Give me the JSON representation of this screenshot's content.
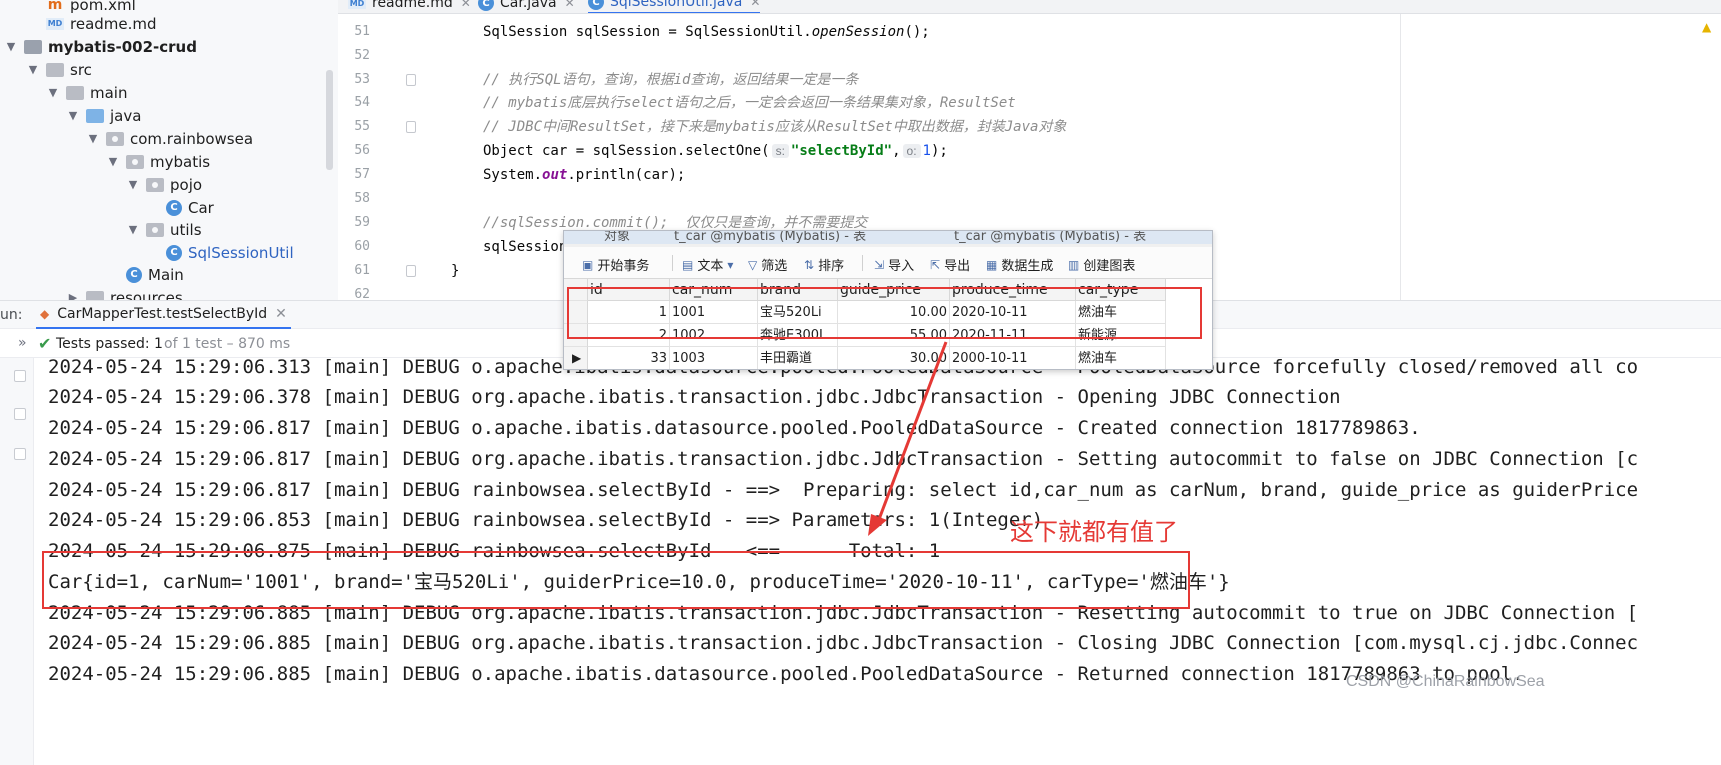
{
  "project_tree": {
    "items": [
      {
        "label": "pom.xml",
        "icon": "maven-file-icon"
      },
      {
        "label": "readme.md",
        "icon": "markdown-file-icon"
      },
      {
        "label": "mybatis-002-crud",
        "icon": "module-folder-icon"
      },
      {
        "label": "src",
        "icon": "folder-icon"
      },
      {
        "label": "main",
        "icon": "folder-icon"
      },
      {
        "label": "java",
        "icon": "source-folder-icon"
      },
      {
        "label": "com.rainbowsea",
        "icon": "package-icon"
      },
      {
        "label": "mybatis",
        "icon": "package-icon"
      },
      {
        "label": "pojo",
        "icon": "package-icon"
      },
      {
        "label": "Car",
        "icon": "class-icon"
      },
      {
        "label": "utils",
        "icon": "package-icon"
      },
      {
        "label": "SqlSessionUtil",
        "icon": "class-icon"
      },
      {
        "label": "Main",
        "icon": "class-icon"
      },
      {
        "label": "resources",
        "icon": "folder-icon"
      }
    ]
  },
  "editor": {
    "tabs": [
      {
        "label": "readme.md"
      },
      {
        "label": "Car.java"
      },
      {
        "label": "SqlSessionUtil.java"
      }
    ],
    "line_numbers": [
      "51",
      "52",
      "53",
      "54",
      "55",
      "56",
      "57",
      "58",
      "59",
      "60",
      "61",
      "62"
    ],
    "lines": {
      "l51_a": "SqlSession sqlSession = SqlSessionUtil.",
      "l51_b": "openSession",
      "l51_c": "();",
      "l53": "// 执行SQL语句，查询，根据id查询，返回结果一定是一条",
      "l54": "// mybatis底层执行select语句之后，一定会会返回一条结果集对象，ResultSet",
      "l55": "// JDBC中间ResultSet，接下来是mybatis应该从ResultSet中取出数据，封装Java对象",
      "l56_a": "Object car = sqlSession.selectOne(",
      "l56_hint1": "s:",
      "l56_str": "\"selectById\"",
      "l56_comma": ",",
      "l56_hint2": "o:",
      "l56_num": "1",
      "l56_end": ");",
      "l57_a": "System.",
      "l57_out": "out",
      "l57_b": ".println(car);",
      "l59": "//sqlSession.commit();  仅仅只是查询，并不需要提交",
      "l60": "sqlSession",
      "l61": "}"
    }
  },
  "run_panel": {
    "prefix": "un:",
    "tab_label": "CarMapperTest.testSelectById",
    "test_status": "Tests passed: 1",
    "test_detail": "of 1 test – 870 ms"
  },
  "console": {
    "lines": [
      "2024-05-24 15:29:06.313 [main] DEBUG o.apache.ibatis.datasource.pooled.PooledDataSource - PooledDataSource forcefully closed/removed all co",
      "2024-05-24 15:29:06.378 [main] DEBUG org.apache.ibatis.transaction.jdbc.JdbcTransaction - Opening JDBC Connection",
      "2024-05-24 15:29:06.817 [main] DEBUG o.apache.ibatis.datasource.pooled.PooledDataSource - Created connection 1817789863.",
      "2024-05-24 15:29:06.817 [main] DEBUG org.apache.ibatis.transaction.jdbc.JdbcTransaction - Setting autocommit to false on JDBC Connection [c",
      "2024-05-24 15:29:06.817 [main] DEBUG rainbowsea.selectById - ==>  Preparing: select id,car_num as carNum, brand, guide_price as guiderPrice",
      "2024-05-24 15:29:06.853 [main] DEBUG rainbowsea.selectById - ==> Parameters: 1(Integer)",
      "2024-05-24 15:29:06.875 [main] DEBUG rainbowsea.selectById - <==      Total: 1",
      "Car{id=1, carNum='1001', brand='宝马520Li', guiderPrice=10.0, produceTime='2020-10-11', carType='燃油车'}",
      "2024-05-24 15:29:06.885 [main] DEBUG org.apache.ibatis.transaction.jdbc.JdbcTransaction - Resetting autocommit to true on JDBC Connection [",
      "2024-05-24 15:29:06.885 [main] DEBUG org.apache.ibatis.transaction.jdbc.JdbcTransaction - Closing JDBC Connection [com.mysql.cj.jdbc.Connec",
      "2024-05-24 15:29:06.885 [main] DEBUG o.apache.ibatis.datasource.pooled.PooledDataSource - Returned connection 1817789863 to pool."
    ]
  },
  "db_window": {
    "tabs": [
      "对象",
      "t_car @mybatis (Mybatis) - 表",
      "t_car @mybatis (Mybatis) - 表"
    ],
    "toolbar": [
      "开始事务",
      "文本",
      "筛选",
      "排序",
      "导入",
      "导出",
      "数据生成",
      "创建图表"
    ],
    "columns": [
      "id",
      "car_num",
      "brand",
      "guide_price",
      "produce_time",
      "car_type"
    ],
    "rows": [
      [
        "1",
        "1001",
        "宝马520Li",
        "10.00",
        "2020-10-11",
        "燃油车"
      ],
      [
        "2",
        "1002",
        "奔驰E300L",
        "55.00",
        "2020-11-11",
        "新能源"
      ],
      [
        "33",
        "1003",
        "丰田霸道",
        "30.00",
        "2000-10-11",
        "燃油车"
      ]
    ]
  },
  "annotation": {
    "text": "这下就都有值了",
    "color": "#e53935"
  },
  "watermark": "CSDN @ChinaRainbowSea"
}
